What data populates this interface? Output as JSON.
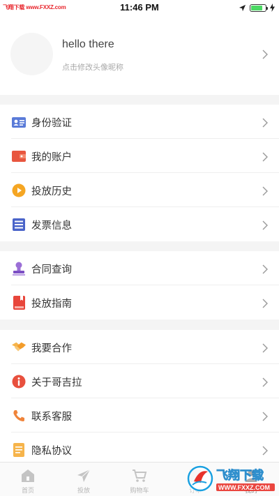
{
  "status_bar": {
    "watermark": "飞翔下载 www.FXXZ.com",
    "time": "11:46 PM",
    "battery_level": 0.8
  },
  "profile": {
    "name": "hello there",
    "hint": "点击修改头像昵称"
  },
  "menu": {
    "group1": [
      {
        "label": "身份验证",
        "icon": "id-card-icon"
      },
      {
        "label": "我的账户",
        "icon": "wallet-icon"
      },
      {
        "label": "投放历史",
        "icon": "play-circle-icon"
      },
      {
        "label": "发票信息",
        "icon": "invoice-icon"
      }
    ],
    "group2": [
      {
        "label": "合同查询",
        "icon": "stamp-icon"
      },
      {
        "label": "投放指南",
        "icon": "guide-book-icon"
      }
    ],
    "group3": [
      {
        "label": "我要合作",
        "icon": "handshake-icon"
      },
      {
        "label": "关于哥吉拉",
        "icon": "info-icon"
      },
      {
        "label": "联系客服",
        "icon": "phone-icon"
      },
      {
        "label": "隐私协议",
        "icon": "document-icon"
      }
    ]
  },
  "tabbar": {
    "tabs": [
      {
        "label": "首页",
        "icon": "home-icon"
      },
      {
        "label": "投放",
        "icon": "paper-plane-icon"
      },
      {
        "label": "购物车",
        "icon": "cart-icon"
      },
      {
        "label": "订单",
        "icon": "order-icon"
      },
      {
        "label": "我的",
        "icon": "profile-icon"
      }
    ]
  },
  "overlay_watermark": {
    "brand": "飞翔下载",
    "url": "WWW.FXXZ.COM"
  },
  "colors": {
    "gap": "#f4f4f4",
    "text": "#333333",
    "chevron": "#999999",
    "tab_inactive": "#b5b5b5"
  }
}
